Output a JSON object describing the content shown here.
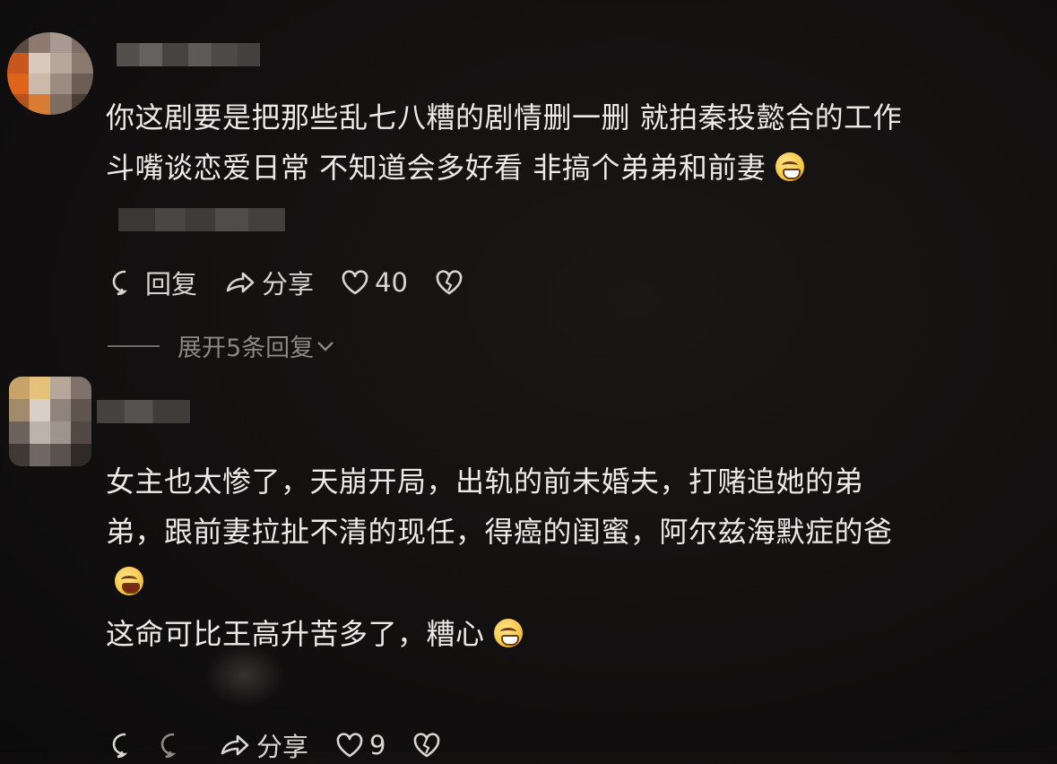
{
  "comments": [
    {
      "text_line1": "你这剧要是把那些乱七八糟的剧情删一删 就拍秦投懿合的工作",
      "text_line2": "斗嘴谈恋爱日常 不知道会多好看 非搞个弟弟和前妻",
      "emoji": "grinning-sweat-emoji",
      "reply_label": "回复",
      "share_label": "分享",
      "like_count": "40",
      "expand_label": "展开5条回复"
    },
    {
      "text_line1": "女主也太惨了，天崩开局，出轨的前未婚夫，打赌追她的弟",
      "text_line2": "弟，跟前妻拉扯不清的现任，得癌的闺蜜，阿尔兹海默症的爸",
      "text_line3": "",
      "text_line4": "这命可比王高升苦多了，糟心",
      "emoji_line3": "crying-laughing-emoji",
      "emoji_line4": "facepalm-emoji",
      "share_label": "分享",
      "like_count": "9"
    }
  ],
  "colors": {
    "background": "#121010",
    "text": "#ece9e6",
    "muted": "#8b8784"
  }
}
